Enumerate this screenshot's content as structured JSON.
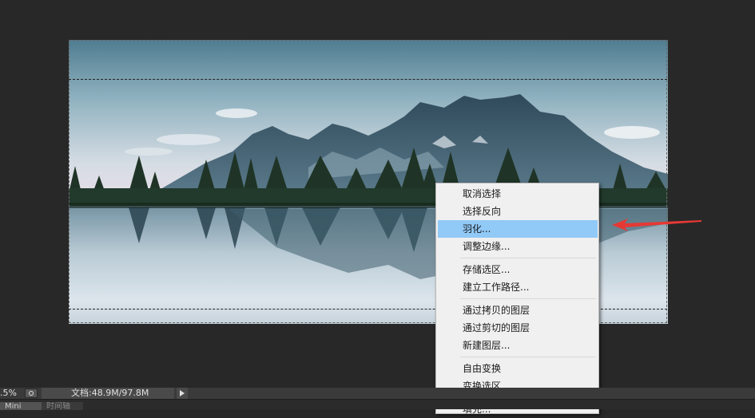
{
  "status": {
    "zoom": ".5%",
    "doc_info": "文档:48.9M/97.8M"
  },
  "context_menu": {
    "items": [
      {
        "label": "取消选择"
      },
      {
        "label": "选择反向"
      },
      {
        "label": "羽化..."
      },
      {
        "label": "调整边缘..."
      },
      {
        "label": "存储选区..."
      },
      {
        "label": "建立工作路径..."
      },
      {
        "label": "通过拷贝的图层"
      },
      {
        "label": "通过剪切的图层"
      },
      {
        "label": "新建图层..."
      },
      {
        "label": "自由变换"
      },
      {
        "label": "变换选区"
      },
      {
        "label": "填充..."
      }
    ],
    "highlighted": "羽化..."
  },
  "panel_tabs": [
    {
      "label": "Mini Bridge"
    },
    {
      "label": "时间轴"
    }
  ],
  "colors": {
    "app_background": "#282828",
    "menu_background": "#f0f0f0",
    "menu_highlight": "#91c9f7",
    "annotation_arrow": "#e53935"
  },
  "icons": {
    "status_button": "status-info-icon",
    "menu_button": "play-triangle-icon",
    "annotation": "red-arrow-icon"
  }
}
